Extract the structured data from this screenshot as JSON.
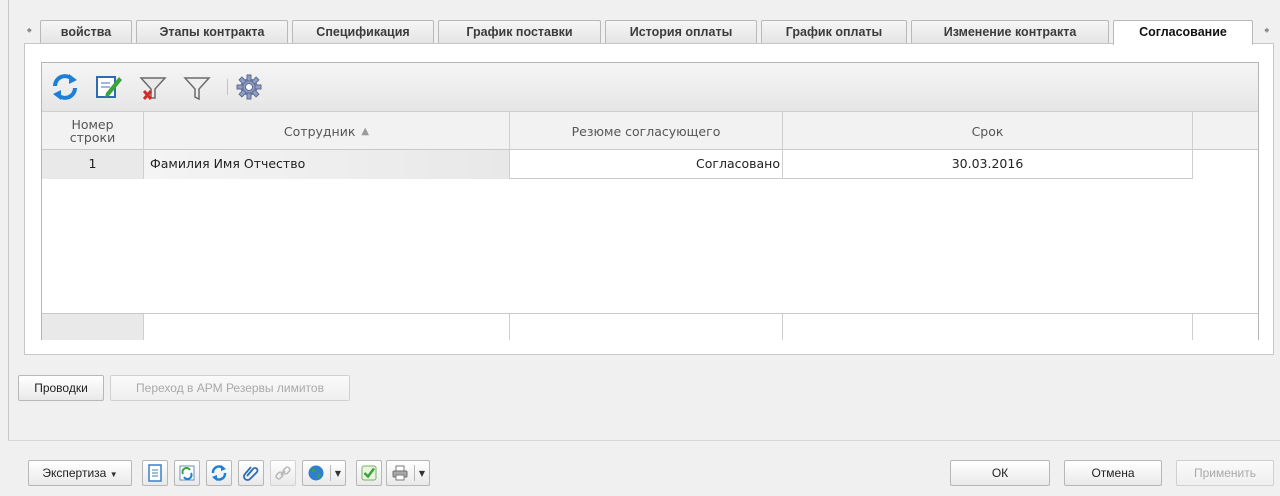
{
  "tabs": {
    "items": [
      {
        "label": "войства",
        "active": false
      },
      {
        "label": "Этапы контракта",
        "active": false
      },
      {
        "label": "Спецификация",
        "active": false
      },
      {
        "label": "График поставки",
        "active": false
      },
      {
        "label": "История оплаты",
        "active": false
      },
      {
        "label": "График оплаты",
        "active": false
      },
      {
        "label": "Изменение контракта",
        "active": false
      },
      {
        "label": "Согласование",
        "active": true
      }
    ],
    "scroll_left_icon": "arrow-left-icon",
    "scroll_right_icon": "arrow-right-icon"
  },
  "grid_toolbar": {
    "icons": [
      "refresh-icon",
      "edit-icon",
      "clear-filter-icon",
      "filter-icon",
      "settings-gear-icon"
    ]
  },
  "grid": {
    "columns": {
      "row_number": "Номер строки",
      "employee": "Сотрудник",
      "summary": "Резюме согласующего",
      "term": "Срок"
    },
    "rows": [
      {
        "row_number": "1",
        "employee": "Фамилия Имя Отчество",
        "summary": "Согласовано",
        "term": "30.03.2016"
      }
    ]
  },
  "action_buttons": {
    "postings": "Проводки",
    "goto_arm": "Переход в АРМ Резервы лимитов"
  },
  "footer": {
    "expertise": "Экспертиза",
    "ok": "ОК",
    "cancel": "Отмена",
    "apply": "Применить",
    "icons": [
      "document-icon",
      "recycle-icon",
      "refresh-icon",
      "attach-icon",
      "link-icon",
      "globe-icon",
      "check-icon",
      "print-icon"
    ]
  },
  "colors": {
    "icon_blue": "#1d7fd6",
    "icon_green": "#3aa33a",
    "icon_red": "#d22b2b",
    "border": "#b7b7b7",
    "disabled_text": "#a9a9a9"
  }
}
